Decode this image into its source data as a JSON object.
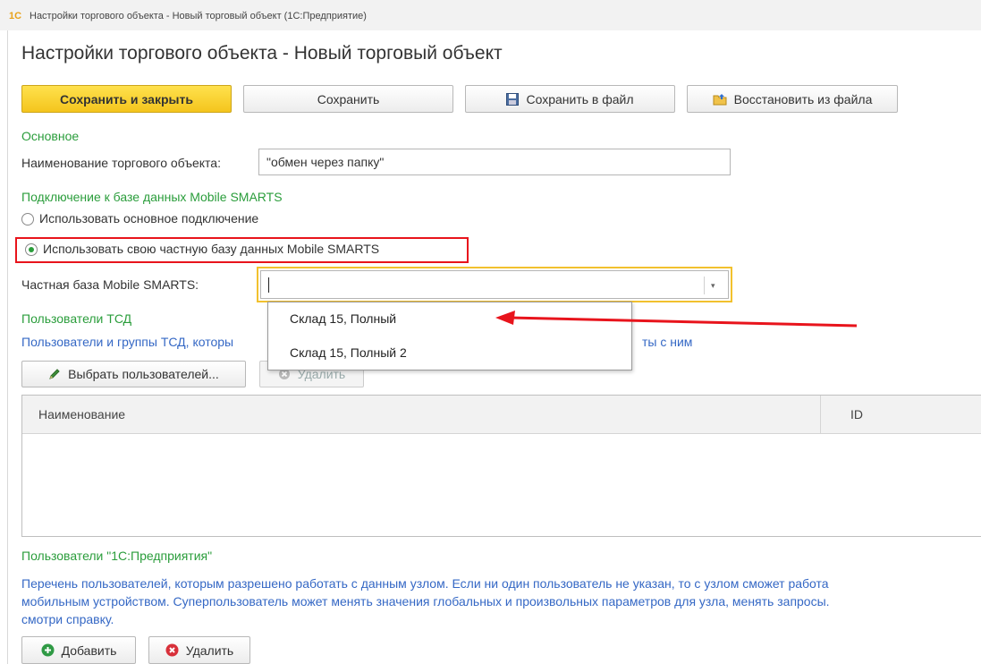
{
  "window": {
    "logo": "1С",
    "title": "Настройки торгового объекта - Новый торговый объект  (1С:Предприятие)"
  },
  "form": {
    "title": "Настройки торгового объекта - Новый торговый объект"
  },
  "toolbar": {
    "save_close": "Сохранить и закрыть",
    "save": "Сохранить",
    "save_file": "Сохранить в файл",
    "restore_file": "Восстановить из файла"
  },
  "basic": {
    "section_title": "Основное",
    "name_label": "Наименование торгового объекта:",
    "name_value": "\"обмен через папку\""
  },
  "connection": {
    "section_title": "Подключение к базе данных Mobile SMARTS",
    "option_main": "Использовать основное подключение",
    "option_private": "Использовать свою частную базу данных Mobile SMARTS",
    "selected": "private",
    "db_label": "Частная база Mobile SMARTS:",
    "db_value": ""
  },
  "dropdown": {
    "items": [
      "Склад 15, Полный",
      "Склад 15, Полный 2"
    ]
  },
  "tsd_users": {
    "section_title": "Пользователи ТСД",
    "description_left": "Пользователи и группы ТСД, которы",
    "description_right": "ты с ним",
    "select_button": "Выбрать пользователей...",
    "delete_button": "Удалить",
    "columns": [
      "Наименование",
      "ID"
    ],
    "rows": []
  },
  "enterprise_users": {
    "section_title": "Пользователи \"1С:Предприятия\"",
    "description_lines": [
      "Перечень пользователей, которым разрешено работать с данным узлом.  Если ни один пользователь не указан, то с узлом сможет работа",
      "мобильным устройством.  Суперпользователь может менять значения глобальных и произвольных параметров для узла, менять запросы.",
      "смотри справку."
    ],
    "add_button": "Добавить",
    "delete_button": "Удалить"
  },
  "colors": {
    "accent_green": "#2a9d3b",
    "link_blue": "#3568c5",
    "highlight_red": "#e8141c",
    "focus_yellow": "#f2c12e",
    "primary_yellow": "#f4c51d"
  },
  "icons": [
    "floppy-icon",
    "folder-open-icon",
    "pencil-icon",
    "plus-circle-icon",
    "x-circle-icon",
    "chevron-down-icon"
  ]
}
